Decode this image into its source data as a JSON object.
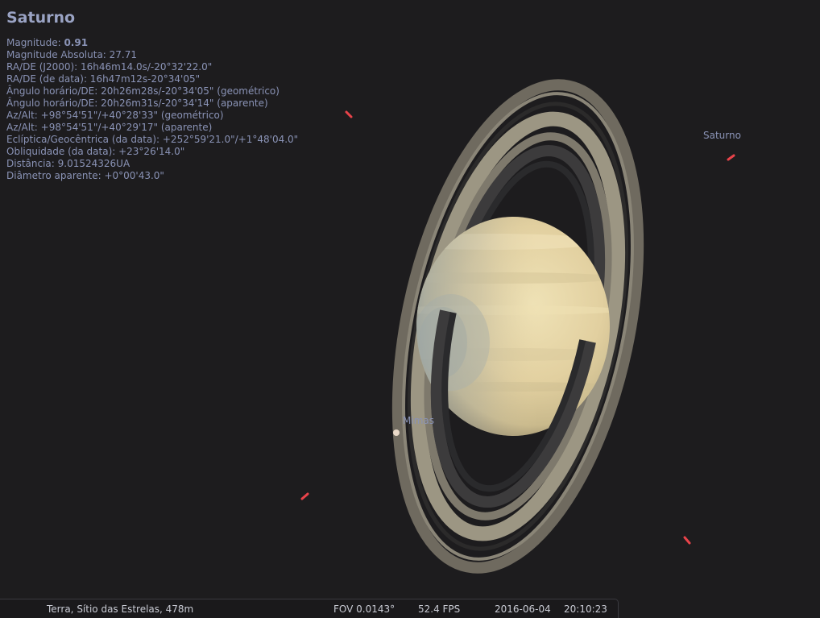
{
  "object": {
    "name": "Saturno",
    "magnitude_label": "Magnitude: ",
    "magnitude_value": "0.91",
    "lines": [
      "Magnitude Absoluta: 27.71",
      "RA/DE (J2000): 16h46m14.0s/-20°32'22.0\"",
      "RA/DE (de data): 16h47m12s-20°34'05\"",
      "Ângulo horário/DE: 20h26m28s/-20°34'05\" (geométrico)",
      "Ângulo horário/DE: 20h26m31s/-20°34'14\" (aparente)",
      "Az/Alt: +98°54'51\"/+40°28'33\" (geométrico)",
      "Az/Alt: +98°54'51\"/+40°29'17\" (aparente)",
      "Eclíptica/Geocêntrica (da data): +252°59'21.0\"/+1°48'04.0\"",
      "Obliquidade (da data): +23°26'14.0\"",
      "Distância: 9.01524326UA",
      "Diâmetro aparente: +0°00'43.0\""
    ]
  },
  "sky_labels": {
    "saturn_marker": "Saturno",
    "moon": "Mimas"
  },
  "status_bar": {
    "location": "Terra, Sítio das Estrelas, 478m",
    "fov": "FOV 0.0143°",
    "fps": "52.4 FPS",
    "date": "2016-06-04",
    "time": "20:10:23"
  },
  "colors": {
    "background": "#1d1c1e",
    "label_text": "#8a93b6",
    "marker_red": "#e8434a"
  }
}
